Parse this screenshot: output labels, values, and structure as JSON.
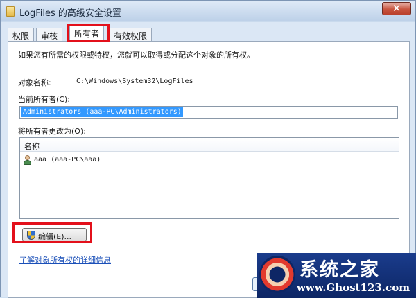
{
  "window": {
    "title": "LogFiles 的高级安全设置",
    "close_label": "✕"
  },
  "tabs": [
    {
      "label": "权限"
    },
    {
      "label": "审核"
    },
    {
      "label": "所有者",
      "active": true
    },
    {
      "label": "有效权限"
    }
  ],
  "owner_page": {
    "intro": "如果您有所需的权限或特权，您就可以取得或分配这个对象的所有权。",
    "object_name_label": "对象名称:",
    "object_name_value": "C:\\Windows\\System32\\LogFiles",
    "current_owner_label": "当前所有者(C):",
    "current_owner_value": "Administrators (aaa-PC\\Administrators)",
    "change_owner_label": "将所有者更改为(O):",
    "list": {
      "column_header": "名称",
      "items": [
        {
          "label": "aaa (aaa-PC\\aaa)",
          "icon": "user-icon"
        }
      ]
    },
    "edit_button_label": "编辑(E)...",
    "learn_more_link": "了解对象所有权的详细信息"
  },
  "highlight_color": "#e3101b",
  "selection_color": "#3399ff",
  "watermark": {
    "title": "系统之家",
    "url": "www.Ghost123.com"
  }
}
